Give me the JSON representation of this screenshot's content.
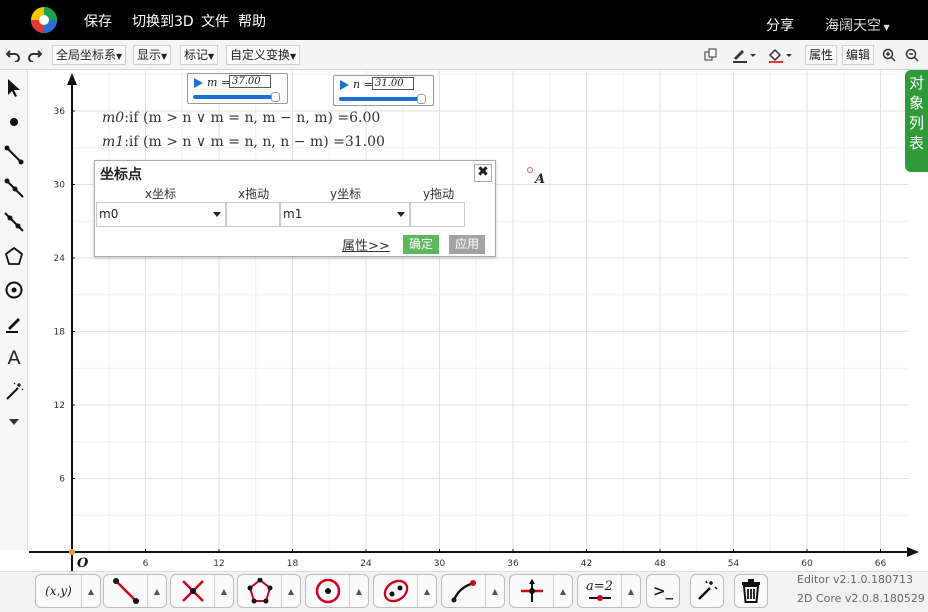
{
  "menubar": {
    "items": [
      "保存",
      "切换到3D",
      "文件",
      "帮助"
    ],
    "share": "分享",
    "user": "海阔天空"
  },
  "toolbar": {
    "coord_system": "全局坐标系",
    "display": "显示",
    "mark": "标记",
    "custom_transform": "自定义变换",
    "properties": "属性",
    "edit": "编辑"
  },
  "sliders": [
    {
      "name": "m",
      "value": "37.00",
      "fraction": 1.0
    },
    {
      "name": "n",
      "value": "31.00",
      "fraction": 1.0
    }
  ],
  "expressions": [
    {
      "label": "m0",
      "formula": ":if (m > n ∨ m = n, m − n, m) =6.00"
    },
    {
      "label": "m1",
      "formula": ":if (m > n ∨ m = n, n, n − m) =31.00"
    }
  ],
  "point_label": "A",
  "dialog": {
    "title": "坐标点",
    "close": "✖",
    "col_x": "x坐标",
    "col_x_drag": "x拖动",
    "col_y": "y坐标",
    "col_y_drag": "y拖动",
    "x_value": "m0",
    "y_value": "m1",
    "attributes_link": "属性>>",
    "confirm": "确定",
    "apply": "应用"
  },
  "object_list_tab": [
    "对",
    "象",
    "列",
    "表"
  ],
  "axes": {
    "x_ticks": [
      "6",
      "12",
      "18",
      "24",
      "30",
      "36",
      "42",
      "48",
      "54",
      "60",
      "66"
    ],
    "y_ticks": [
      "6",
      "12",
      "18",
      "24",
      "30",
      "36"
    ],
    "origin": "O"
  },
  "bottom": {
    "point_tool_label": "(x,y)",
    "param_tool_label": "a=2",
    "console_label": ">_"
  },
  "version": {
    "editor": "Editor v2.1.0.180713",
    "core": "2D Core v2.0.8.180529"
  },
  "colors": {
    "accent_blue": "#1d6fd6",
    "confirm_green": "#5cb85c",
    "apply_gray": "#a3a3a3",
    "object_tab_green": "#2e9a3a",
    "tool_red": "#d0021b"
  }
}
